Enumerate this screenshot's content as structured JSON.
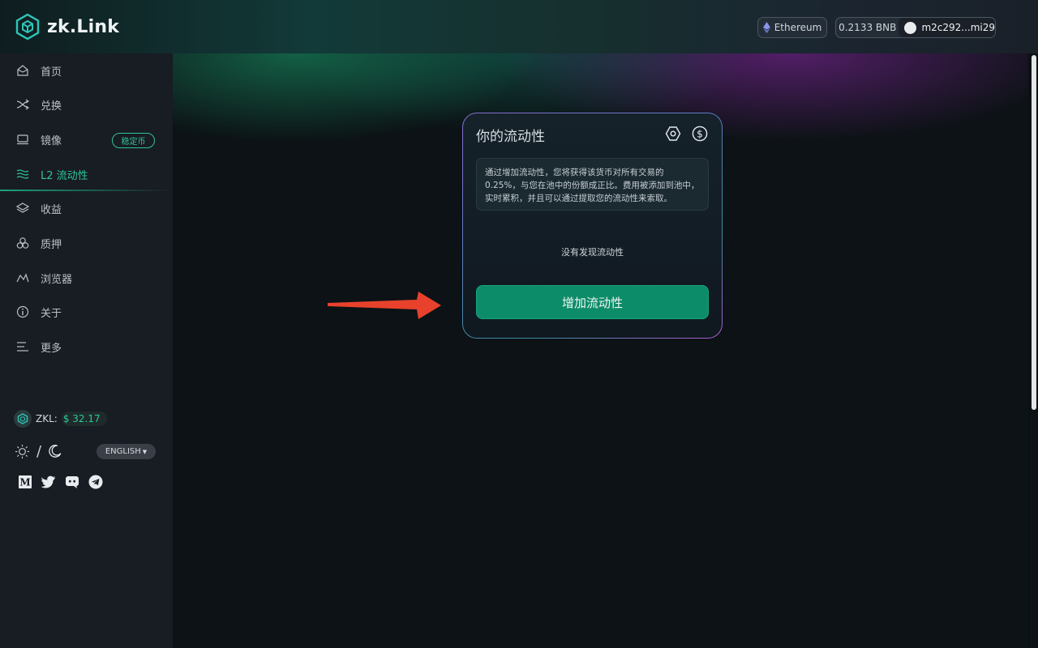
{
  "header": {
    "brand": "zk.Link",
    "network": "Ethereum",
    "balance": "0.2133 BNB",
    "address": "m2c292...mi29"
  },
  "sidebar": {
    "items": [
      {
        "label": "首页",
        "icon": "home-icon"
      },
      {
        "label": "兑换",
        "icon": "swap-icon"
      },
      {
        "label": "镜像",
        "icon": "laptop-icon",
        "badge": "稳定币"
      },
      {
        "label": "L2 流动性",
        "icon": "waves-icon",
        "active": true
      },
      {
        "label": "收益",
        "icon": "layers-icon"
      },
      {
        "label": "质押",
        "icon": "circles-icon"
      },
      {
        "label": "浏览器",
        "icon": "chart-line-icon"
      },
      {
        "label": "关于",
        "icon": "info-icon"
      },
      {
        "label": "更多",
        "icon": "menu-icon"
      }
    ],
    "zkl_label": "ZKL:",
    "zkl_price": "$ 32.17",
    "theme_separator": "/",
    "language": "ENGLISH"
  },
  "card": {
    "title": "你的流动性",
    "info": "通过增加流动性，您将获得该货币对所有交易的 0.25%，与您在池中的份额成正比。费用被添加到池中，实时累积，并且可以通过提取您的流动性来索取。",
    "empty": "没有发现流动性",
    "add_button": "增加流动性"
  },
  "colors": {
    "accent": "#2ec598",
    "button": "#0d8c69",
    "arrow": "#e8412c"
  }
}
